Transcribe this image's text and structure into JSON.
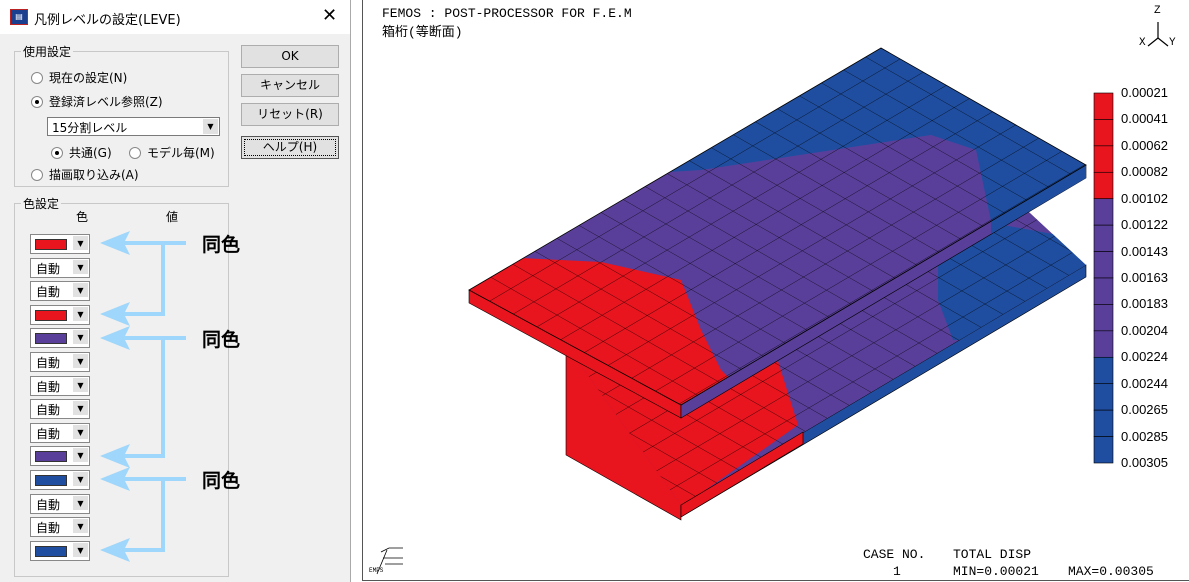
{
  "dialog": {
    "title": "凡例レベルの設定(LEVE)",
    "icon": "app-icon",
    "usage_group": "使用設定",
    "radio_current": "現在の設定(N)",
    "radio_registered": "登録済レベル参照(Z)",
    "radio_capture": "描画取り込み(A)",
    "level_select": "15分割レベル",
    "radio_common": "共通(G)",
    "radio_per_model": "モデル毎(M)",
    "buttons": {
      "ok": "OK",
      "cancel": "キャンセル",
      "reset": "リセット(R)",
      "help": "ヘルプ(H)"
    },
    "color_group": "色設定",
    "col_color": "色",
    "col_value": "値",
    "auto_label": "自動",
    "rows": [
      {
        "type": "color",
        "color": "#e8141e"
      },
      {
        "type": "auto"
      },
      {
        "type": "auto"
      },
      {
        "type": "color",
        "color": "#e8141e"
      },
      {
        "type": "color",
        "color": "#5a3f9a"
      },
      {
        "type": "auto"
      },
      {
        "type": "auto"
      },
      {
        "type": "auto"
      },
      {
        "type": "auto"
      },
      {
        "type": "color",
        "color": "#5a3f9a"
      },
      {
        "type": "color",
        "color": "#1f4ea0"
      },
      {
        "type": "auto"
      },
      {
        "type": "auto"
      },
      {
        "type": "color",
        "color": "#1f4ea0"
      }
    ],
    "same_color_label": "同色"
  },
  "viewer": {
    "header1": "FEMOS   :  POST-PROCESSOR   FOR  F.E.M",
    "header2": "箱桁(等断面)",
    "axes": {
      "z": "Z",
      "x": "X",
      "y": "Y"
    },
    "legend": [
      "0.00021",
      "0.00041",
      "0.00062",
      "0.00082",
      "0.00102",
      "0.00122",
      "0.00143",
      "0.00163",
      "0.00183",
      "0.00204",
      "0.00224",
      "0.00244",
      "0.00265",
      "0.00285",
      "0.00305"
    ],
    "legend_colors": [
      "#e8141e",
      "#e8141e",
      "#e8141e",
      "#e8141e",
      "#5a3f9a",
      "#5a3f9a",
      "#5a3f9a",
      "#5a3f9a",
      "#5a3f9a",
      "#5a3f9a",
      "#1f4ea0",
      "#1f4ea0",
      "#1f4ea0",
      "#1f4ea0"
    ],
    "case_label": "CASE NO.",
    "case_value": "1",
    "result_label": "TOTAL   DISP",
    "min": "MIN=0.00021",
    "max": "MAX=0.00305",
    "logo": "EMPS"
  }
}
